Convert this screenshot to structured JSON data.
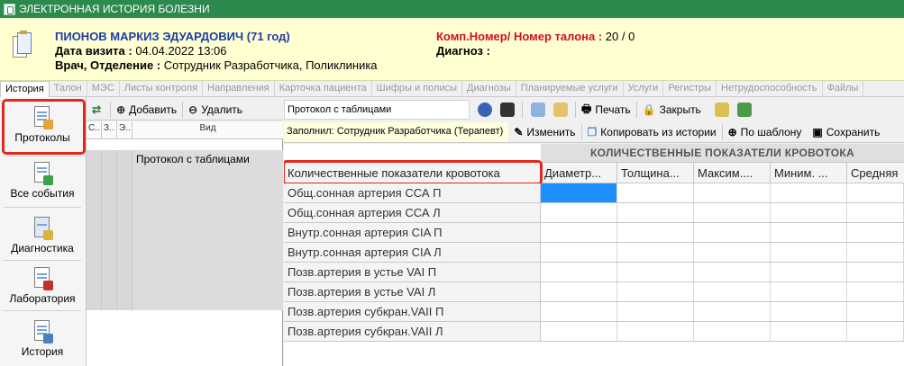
{
  "window": {
    "title": "ЭЛЕКТРОННАЯ ИСТОРИЯ БОЛЕЗНИ"
  },
  "patient": {
    "name": "ПИОНОВ МАРКИЗ ЭДУАРДОВИЧ (71 год)",
    "visit_label": "Дата визита :",
    "visit_value": "04.04.2022 13:06",
    "doctor_label": "Врач, Отделение :",
    "doctor_value": "Сотрудник Разработчика, Поликлиника",
    "comp_label": "Комп.Номер/ Номер талона :",
    "comp_value": "20 / 0",
    "diag_label": "Диагноз :",
    "diag_value": ""
  },
  "tabs": [
    "История",
    "Талон",
    "МЭС",
    "Листы контроля",
    "Направления",
    "Карточка пациента",
    "Шифры и полисы",
    "Диагнозы",
    "Планируемые услуги",
    "Услуги",
    "Регистры",
    "Нетрудоспособность",
    "Файлы"
  ],
  "sidebar": {
    "items": [
      {
        "label": "Протоколы",
        "icon": "protocol-doc-icon"
      },
      {
        "label": "Все события",
        "icon": "events-doc-icon"
      },
      {
        "label": "Диагностика",
        "icon": "diagnostics-icon"
      },
      {
        "label": "Лаборатория",
        "icon": "lab-icon"
      },
      {
        "label": "История",
        "icon": "history-icon"
      }
    ]
  },
  "left_toolbar": {
    "add": "Добавить",
    "delete": "Удалить"
  },
  "left_grid": {
    "columns": [
      "С..",
      "З..",
      "Э..",
      "Вид"
    ],
    "rows": [
      {
        "name": "Протокол с таблицами"
      }
    ]
  },
  "protocol": {
    "title": "Протокол с таблицами",
    "print": "Печать",
    "close": "Закрыть",
    "filled_by": "Заполнил: Сотрудник Разработчика  (Терапевт)",
    "edit": "Изменить",
    "copy_from_history": "Копировать из истории",
    "by_template": "По шаблону",
    "save": "Сохранить"
  },
  "table": {
    "group_title": "КОЛИЧЕСТВЕННЫЕ ПОКАЗАТЕЛИ КРОВОТОКА",
    "row_header": "Количественные показатели кровотока",
    "columns": [
      "Диаметр...",
      "Толщина...",
      "Максим....",
      "Миним. ...",
      "Средняя"
    ],
    "rows": [
      "Общ.сонная артерия ССА П",
      "Общ.сонная артерия ССА Л",
      "Внутр.сонная артерия CIA П",
      "Внутр.сонная артерия CIA Л",
      "Позв.артерия в устье VAI П",
      "Позв.артерия в устье VAI Л",
      "Позв.артерия субкран.VAII П",
      "Позв.артерия субкран.VAII Л"
    ]
  },
  "colors": {
    "title_bar": "#2d8a4e",
    "header_bg": "#ffffd2",
    "patient_name": "#1b3fa3",
    "alert_red": "#d0101a",
    "highlight": "#e0281c",
    "selection": "#1e90ff"
  }
}
